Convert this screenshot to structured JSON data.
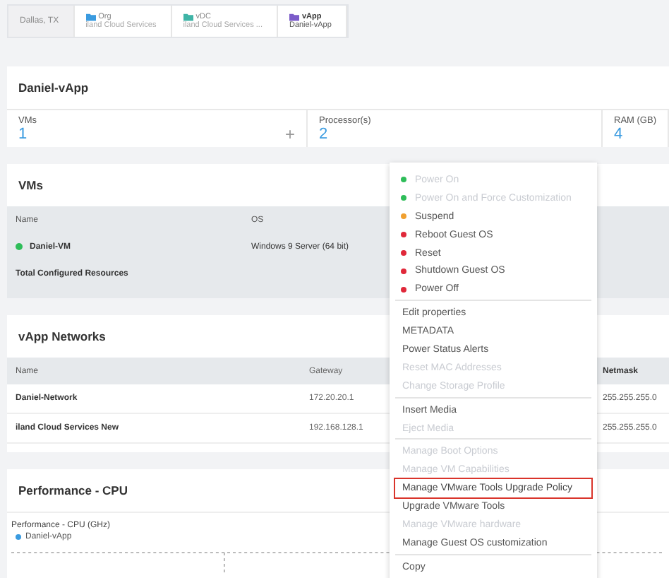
{
  "breadcrumb": [
    {
      "kind": "plain",
      "label": "Dallas, TX"
    },
    {
      "kind": "folder",
      "color": "#3a9be0",
      "type": "Org",
      "label": "iland Cloud Services",
      "selected": false
    },
    {
      "kind": "folder",
      "color": "#3fb4a6",
      "type": "vDC",
      "label": "iland Cloud Services ...",
      "selected": false
    },
    {
      "kind": "folder",
      "color": "#7b5cc9",
      "type": "vApp",
      "label": "Daniel-vApp",
      "selected": true
    }
  ],
  "summary": {
    "title": "Daniel-vApp",
    "stats": [
      {
        "label": "VMs",
        "value": "1",
        "action": "+"
      },
      {
        "label": "Processor(s)",
        "value": "2"
      },
      {
        "label": "RAM (GB)",
        "value": "4"
      }
    ]
  },
  "vms": {
    "title": "VMs",
    "columns": [
      "Name",
      "OS"
    ],
    "rows": [
      {
        "name": "Daniel-VM",
        "os": "Windows 9 Server (64 bit)",
        "color": "#2ebd59"
      }
    ],
    "total": "Total Configured Resources"
  },
  "networks": {
    "title": "vApp Networks",
    "columns": [
      "Name",
      "Gateway",
      "Netmask"
    ],
    "rows": [
      [
        "Daniel-Network",
        "172.20.20.1",
        "255.255.255.0"
      ],
      [
        "iland Cloud Services New",
        "192.168.128.1",
        "255.255.255.0"
      ]
    ]
  },
  "performance": {
    "title": "Performance - CPU",
    "chart_title": "Performance - CPU (GHz)",
    "legend": [
      {
        "name": "Daniel-vApp",
        "color": "#3a9be0"
      }
    ]
  },
  "context_menu": [
    {
      "kind": "action",
      "label": "Power On",
      "color": "#2ebd59",
      "disabled": true
    },
    {
      "kind": "action",
      "label": "Power On and Force Customization",
      "color": "#2ebd59",
      "disabled": true
    },
    {
      "kind": "action",
      "label": "Suspend",
      "color": "#f0a030",
      "disabled": false
    },
    {
      "kind": "action",
      "label": "Reboot Guest OS",
      "color": "#e0283a",
      "disabled": false
    },
    {
      "kind": "action",
      "label": "Reset",
      "color": "#e0283a",
      "disabled": false
    },
    {
      "kind": "action",
      "label": "Shutdown Guest OS",
      "color": "#e0283a",
      "disabled": false
    },
    {
      "kind": "action",
      "label": "Power Off",
      "color": "#e0283a",
      "disabled": false
    },
    {
      "kind": "divider"
    },
    {
      "kind": "item",
      "label": "Edit properties",
      "disabled": false,
      "highlighted": false
    },
    {
      "kind": "item",
      "label": "METADATA",
      "disabled": false,
      "highlighted": false
    },
    {
      "kind": "item",
      "label": "Power Status Alerts",
      "disabled": false,
      "highlighted": false
    },
    {
      "kind": "item",
      "label": "Reset MAC Addresses",
      "disabled": true,
      "highlighted": false
    },
    {
      "kind": "item",
      "label": "Change Storage Profile",
      "disabled": true,
      "highlighted": false
    },
    {
      "kind": "divider"
    },
    {
      "kind": "item",
      "label": "Insert Media",
      "disabled": false,
      "highlighted": false
    },
    {
      "kind": "item",
      "label": "Eject Media",
      "disabled": true,
      "highlighted": false
    },
    {
      "kind": "divider"
    },
    {
      "kind": "item",
      "label": "Manage Boot Options",
      "disabled": true,
      "highlighted": false
    },
    {
      "kind": "item",
      "label": "Manage VM Capabilities",
      "disabled": true,
      "highlighted": false
    },
    {
      "kind": "item",
      "label": "Manage VMware Tools Upgrade Policy",
      "disabled": false,
      "highlighted": true
    },
    {
      "kind": "item",
      "label": "Upgrade VMware Tools",
      "disabled": false,
      "highlighted": false
    },
    {
      "kind": "item",
      "label": "Manage VMware hardware",
      "disabled": true,
      "highlighted": false
    },
    {
      "kind": "item",
      "label": "Manage Guest OS customization",
      "disabled": false,
      "highlighted": false
    },
    {
      "kind": "divider"
    },
    {
      "kind": "item",
      "label": "Copy",
      "disabled": false,
      "highlighted": false
    }
  ]
}
